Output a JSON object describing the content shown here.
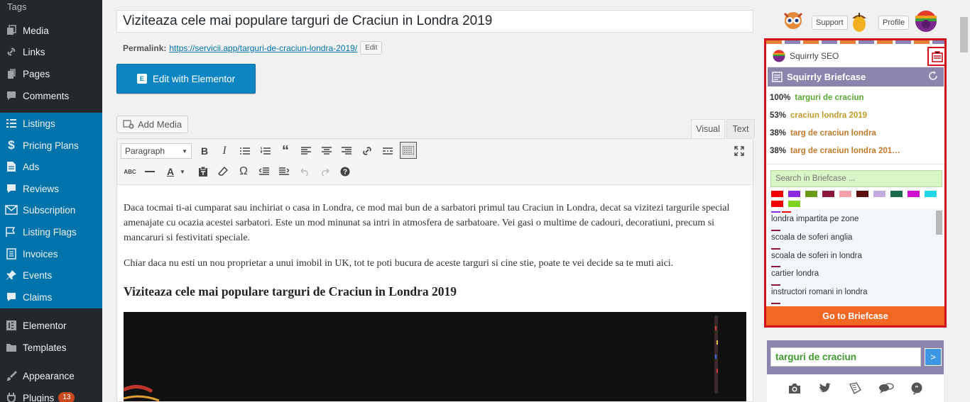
{
  "sidebar": {
    "items": [
      {
        "label": "Tags",
        "icon": "none",
        "group": "sub"
      },
      {
        "label": "Media",
        "icon": "media-icon",
        "group": "dark"
      },
      {
        "label": "Links",
        "icon": "link-icon",
        "group": "dark"
      },
      {
        "label": "Pages",
        "icon": "pages-icon",
        "group": "dark"
      },
      {
        "label": "Comments",
        "icon": "comment-icon",
        "group": "dark"
      },
      {
        "label": "Listings",
        "icon": "list-icon",
        "group": "blue"
      },
      {
        "label": "Pricing Plans",
        "icon": "dollar-icon",
        "group": "blue"
      },
      {
        "label": "Ads",
        "icon": "document-icon",
        "group": "blue"
      },
      {
        "label": "Reviews",
        "icon": "comment-icon",
        "group": "blue"
      },
      {
        "label": "Subscription",
        "icon": "email-icon",
        "group": "blue"
      },
      {
        "label": "Listing Flags",
        "icon": "flag-icon",
        "group": "blue"
      },
      {
        "label": "Invoices",
        "icon": "invoice-icon",
        "group": "blue"
      },
      {
        "label": "Events",
        "icon": "pin-icon",
        "group": "blue"
      },
      {
        "label": "Claims",
        "icon": "comment-icon",
        "group": "blue"
      },
      {
        "label": "Elementor",
        "icon": "elementor-icon",
        "group": "dark"
      },
      {
        "label": "Templates",
        "icon": "folder-icon",
        "group": "dark"
      },
      {
        "label": "Appearance",
        "icon": "brush-icon",
        "group": "dark"
      },
      {
        "label": "Plugins",
        "icon": "plugin-icon",
        "group": "dark",
        "badge": "13"
      }
    ]
  },
  "editor": {
    "title": "Viziteaza cele mai populare targuri de Craciun in Londra 2019",
    "permalink_label": "Permalink:",
    "permalink_base": "https://servicii.app/",
    "permalink_slug": "targuri-de-craciun-londra-2019/",
    "permalink_edit": "Edit",
    "elementor_button": "Edit with Elementor",
    "add_media": "Add Media",
    "tab_visual": "Visual",
    "tab_text": "Text",
    "format_select": "Paragraph",
    "paragraph_1": "Daca tocmai ti-ai cumparat sau inchiriat o casa in Londra, ce mod mai bun de a sarbatori primul tau Craciun in Londra, decat sa vizitezi targurile special amenajate cu ocazia acestei sarbatori. Este un mod minunat sa intri in atmosfera de sarbatoare. Vei gasi o multime de cadouri, decoratiuni, precum si mancaruri si festivitati speciale.",
    "paragraph_2": "Chiar daca nu esti un nou proprietar a unui imobil in UK, tot te poti bucura de aceste targuri si cine stie, poate te vei decide sa te muti aici.",
    "heading": "Viziteaza cele mai populare targuri de Craciun in Londra 2019"
  },
  "squirrly_top": {
    "support": "Support",
    "profile": "Profile"
  },
  "squirrly": {
    "title": "Squirrly SEO",
    "briefcase_title": "Squirrly Briefcase",
    "keywords": [
      {
        "pct": "100%",
        "kw": "targuri de craciun",
        "color": "#5aa832"
      },
      {
        "pct": "53%",
        "kw": "craciun londra 2019",
        "color": "#c29a2a"
      },
      {
        "pct": "38%",
        "kw": "targ de craciun londra",
        "color": "#c27a2a"
      },
      {
        "pct": "38%",
        "kw": "targ de craciun londra 201…",
        "color": "#c27a2a"
      }
    ],
    "search_placeholder": "Search in Briefcase ...",
    "swatches": [
      "#f00000",
      "#8a2be2",
      "#6a9a1a",
      "#8b1a3a",
      "#f4a0a8",
      "#5a0f0f",
      "#c4a8e0",
      "#1a6a4a",
      "#d010d0",
      "#20d8e8",
      "#f00000",
      "#7ed321"
    ],
    "briefcase_items": [
      "londra impartita pe zone",
      "scoala de soferi anglia",
      "scoala de soferi in londra",
      "cartier londra",
      "instructori romani in londra"
    ],
    "go_briefcase": "Go to Briefcase",
    "keyword_input": "targuri de craciun",
    "keyword_go": ">"
  }
}
